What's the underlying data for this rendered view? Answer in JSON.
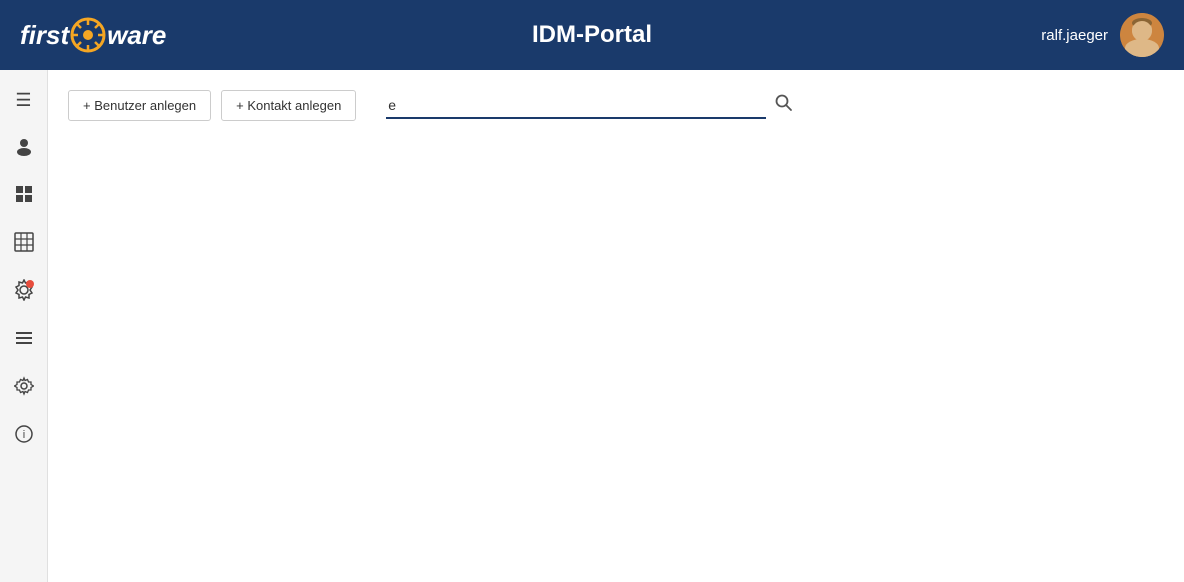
{
  "header": {
    "logo_first": "first",
    "logo_ware": "ware",
    "title": "IDM-Portal",
    "username": "ralf.jaeger"
  },
  "toolbar": {
    "add_user_label": "+ Benutzer anlegen",
    "add_contact_label": "+ Kontakt anlegen"
  },
  "search": {
    "value": "e",
    "placeholder": ""
  },
  "sidebar": {
    "items": [
      {
        "name": "menu-icon",
        "icon": "☰",
        "label": "Menu"
      },
      {
        "name": "user-icon",
        "icon": "👤",
        "label": "User"
      },
      {
        "name": "grid-icon",
        "icon": "⊞",
        "label": "Grid"
      },
      {
        "name": "table-icon",
        "icon": "▦",
        "label": "Table"
      },
      {
        "name": "settings-badge-icon",
        "icon": "⚙",
        "label": "Settings Badge"
      },
      {
        "name": "list-icon",
        "icon": "≡",
        "label": "List"
      },
      {
        "name": "gear-icon",
        "icon": "⚙",
        "label": "Gear"
      },
      {
        "name": "info-icon",
        "icon": "ℹ",
        "label": "Info"
      }
    ]
  }
}
